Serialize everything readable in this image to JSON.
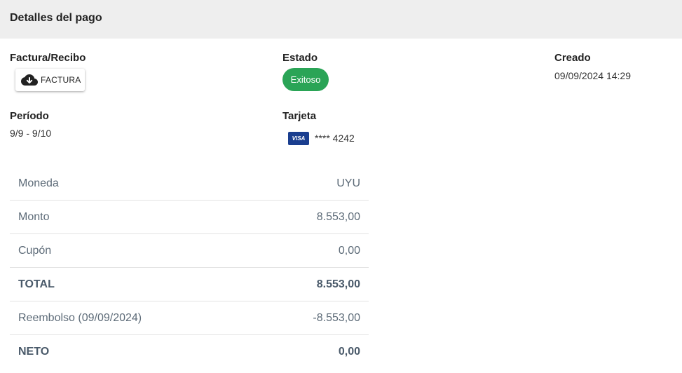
{
  "header": {
    "title": "Detalles del pago"
  },
  "fields": {
    "invoice": {
      "label": "Factura/Recibo",
      "button_label": "FACTURA",
      "icon": "cloud-download-icon"
    },
    "status": {
      "label": "Estado",
      "value": "Exitoso",
      "color": "#2aa456"
    },
    "created": {
      "label": "Creado",
      "value": "09/09/2024 14:29"
    },
    "period": {
      "label": "Período",
      "value": "9/9 - 9/10"
    },
    "card": {
      "label": "Tarjeta",
      "brand": "VISA",
      "number": "**** 4242",
      "brand_color": "#1a3e8f"
    }
  },
  "summary": [
    {
      "label": "Moneda",
      "value": "UYU"
    },
    {
      "label": "Monto",
      "value": "8.553,00"
    },
    {
      "label": "Cupón",
      "value": "0,00"
    },
    {
      "label": "TOTAL",
      "value": "8.553,00"
    },
    {
      "label": "Reembolso (09/09/2024)",
      "value": "-8.553,00"
    },
    {
      "label": "NETO",
      "value": "0,00"
    }
  ]
}
